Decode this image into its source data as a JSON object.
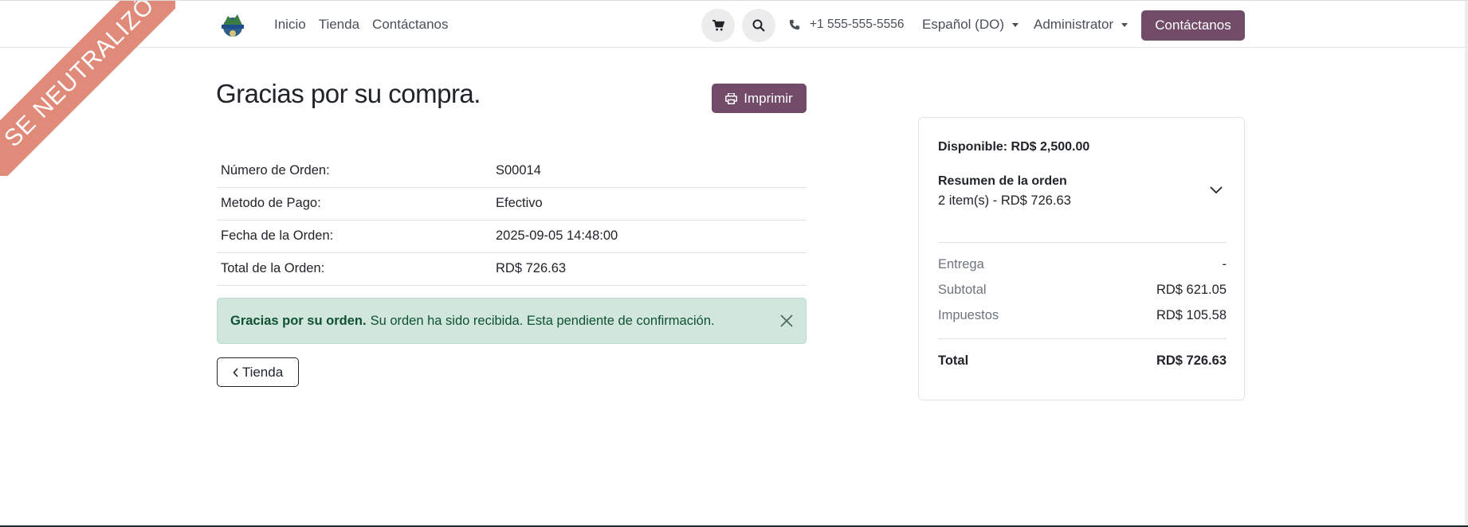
{
  "ribbon": {
    "text": "SE NEUTRALIZÓ"
  },
  "header": {
    "nav": [
      "Inicio",
      "Tienda",
      "Contáctanos"
    ],
    "phone": "+1 555-555-5556",
    "language": "Español (DO)",
    "user": "Administrator",
    "contact_button": "Contáctanos"
  },
  "main": {
    "title": "Gracias por su compra.",
    "print_button": "Imprimir",
    "order_info": [
      {
        "label": "Número de Orden:",
        "value": "S00014"
      },
      {
        "label": "Metodo de Pago:",
        "value": "Efectivo"
      },
      {
        "label": "Fecha de la Orden:",
        "value": "2025-09-05 14:48:00"
      },
      {
        "label": "Total de la Orden:",
        "value": "RD$ 726.63"
      }
    ],
    "alert": {
      "bold": "Gracias por su orden.",
      "text": "Su orden ha sido recibida. Esta pendiente de confirmación."
    },
    "back_button": "Tienda"
  },
  "summary": {
    "available": "Disponible: RD$ 2,500.00",
    "title": "Resumen de la orden",
    "subtitle": "2 item(s) -  RD$ 726.63",
    "rows": [
      {
        "label": "Entrega",
        "value": "-"
      },
      {
        "label": "Subtotal",
        "value": "RD$ 621.05"
      },
      {
        "label": "Impuestos",
        "value": "RD$ 105.58"
      }
    ],
    "total_label": "Total",
    "total_value": "RD$ 726.63"
  },
  "colors": {
    "brand": "#714b67",
    "alert_bg": "#d1e7dd",
    "ribbon": "#e08a7a"
  },
  "icons": [
    "shopping-cart-icon",
    "search-icon",
    "phone-icon",
    "printer-icon",
    "close-icon",
    "chevron-down-icon",
    "chevron-left-icon"
  ]
}
